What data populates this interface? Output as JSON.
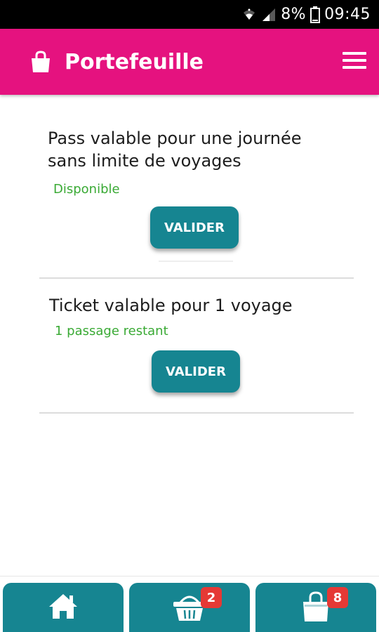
{
  "status_bar": {
    "battery": "8%",
    "time": "09:45",
    "icons": [
      "wifi-icon",
      "signal-icon",
      "battery-icon"
    ]
  },
  "header": {
    "title": "Portefeuille",
    "icon": "shopping-bag-icon",
    "menu_icon": "hamburger-menu-icon",
    "background_color": "#e5127f"
  },
  "wallet": {
    "items": [
      {
        "title_lines": [
          "Pass valable pour une journée",
          "sans limite de voyages"
        ],
        "status": "Disponible",
        "button_label": "VALIDER"
      },
      {
        "title_lines": [
          "Ticket valable pour 1 voyage"
        ],
        "status": "1 passage restant",
        "button_label": "VALIDER"
      }
    ],
    "status_color": "#3aaa35",
    "button_color": "#168591"
  },
  "bottom_nav": {
    "items": [
      {
        "icon": "home-icon"
      },
      {
        "icon": "basket-icon",
        "badge": "2"
      },
      {
        "icon": "shopping-bag-icon",
        "badge": "8"
      }
    ],
    "badge_color": "#e53935"
  }
}
